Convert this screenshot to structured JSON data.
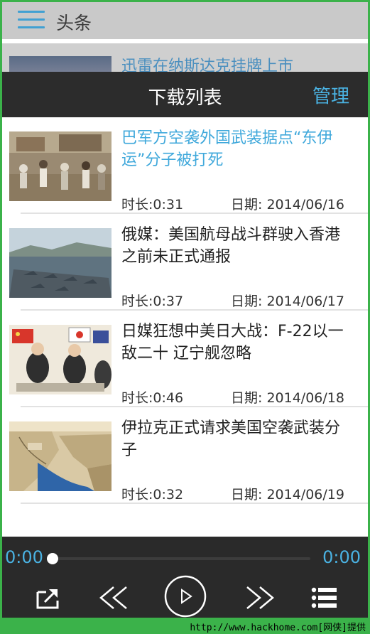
{
  "app": {
    "section_title": "头条",
    "background_headline": "迅雷在纳斯达克挂牌上市"
  },
  "modal": {
    "title": "下载列表",
    "manage_label": "管理"
  },
  "downloads": [
    {
      "title": "巴军方空袭外国武装据点“东伊运”分子被打死",
      "duration": "时长:0:31",
      "date": "日期: 2014/06/16",
      "active": true
    },
    {
      "title": "俄媒：美国航母战斗群驶入香港 之前未正式通报",
      "duration": "时长:0:37",
      "date": "日期: 2014/06/17",
      "active": false
    },
    {
      "title": "日媒狂想中美日大战：F-22以一敌二十 辽宁舰忽略",
      "duration": "时长:0:46",
      "date": "日期: 2014/06/18",
      "active": false
    },
    {
      "title": "伊拉克正式请求美国空袭武装分子",
      "duration": "时长:0:32",
      "date": "日期: 2014/06/19",
      "active": false
    }
  ],
  "player": {
    "elapsed": "0:00",
    "total": "0:00",
    "progress": 0,
    "controls": [
      "share-icon",
      "rewind-icon",
      "play-icon",
      "fast-forward-icon",
      "playlist-icon"
    ]
  },
  "colors": {
    "accent": "#4ab2e2",
    "header_bg": "#2c2c2c",
    "border": "#3bb24a"
  },
  "watermark": "http://www.hackhome.com[网侠]提供"
}
